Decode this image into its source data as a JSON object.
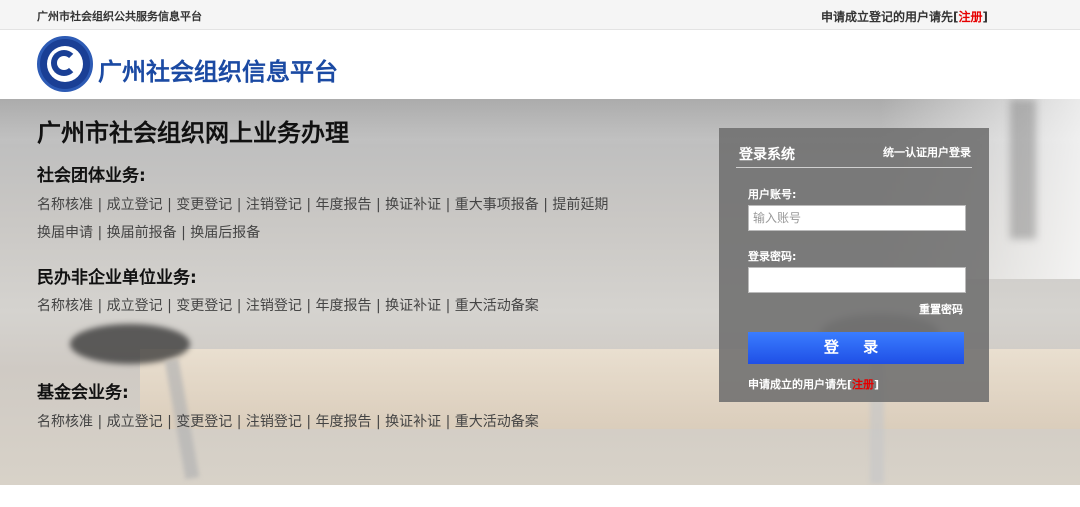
{
  "topbar": {
    "site_name": "广州市社会组织公共服务信息平台",
    "register_prompt": "申请成立登记的用户请先[",
    "register_link": "注册",
    "register_close": "]"
  },
  "header": {
    "logo_icon": "globe-emblem-icon",
    "title": "广州社会组织信息平台"
  },
  "main": {
    "title": "广州市社会组织网上业务办理",
    "sections": [
      {
        "title": "社会团体业务:",
        "links": [
          "名称核准",
          "成立登记",
          "变更登记",
          "注销登记",
          "年度报告",
          "换证补证",
          "重大事项报备",
          "提前延期换届申请",
          "换届前报备",
          "换届后报备"
        ]
      },
      {
        "title": "民办非企业单位业务:",
        "links": [
          "名称核准",
          "成立登记",
          "变更登记",
          "注销登记",
          "年度报告",
          "换证补证",
          "重大活动备案"
        ]
      },
      {
        "title": "基金会业务:",
        "links": [
          "名称核准",
          "成立登记",
          "变更登记",
          "注销登记",
          "年度报告",
          "换证补证",
          "重大活动备案"
        ]
      }
    ]
  },
  "login": {
    "title": "登录系统",
    "unified_login": "统一认证用户登录",
    "account_label": "用户账号:",
    "account_placeholder": "输入账号",
    "password_label": "登录密码:",
    "password_placeholder": "",
    "reset_password": "重置密码",
    "submit_label": "登 录",
    "register_prompt": "申请成立的用户请先[",
    "register_link": "注册",
    "register_close": "]"
  },
  "colors": {
    "brand_blue": "#1b4aa3",
    "register_red": "#e60000",
    "button_blue": "#1f4fe6"
  }
}
